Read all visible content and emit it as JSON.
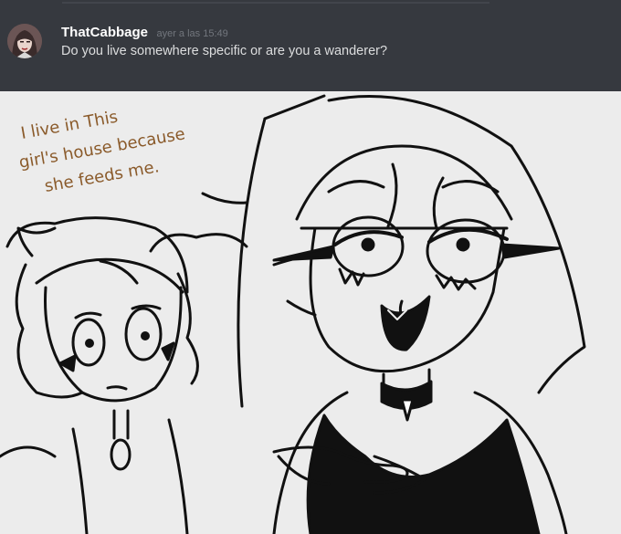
{
  "message": {
    "username": "ThatCabbage",
    "timestamp": "ayer a las 15:49",
    "text": "Do you live somewhere specific or are you a wanderer?"
  },
  "comic": {
    "caption_lines": [
      "I live in This",
      "girl's house because",
      "she feeds me."
    ]
  },
  "colors": {
    "chat_background": "#36393f",
    "username": "#ffffff",
    "message_text": "#dcddde",
    "timestamp": "#72767d",
    "panel_background": "#ececec",
    "caption_ink": "#8a5a2a"
  }
}
